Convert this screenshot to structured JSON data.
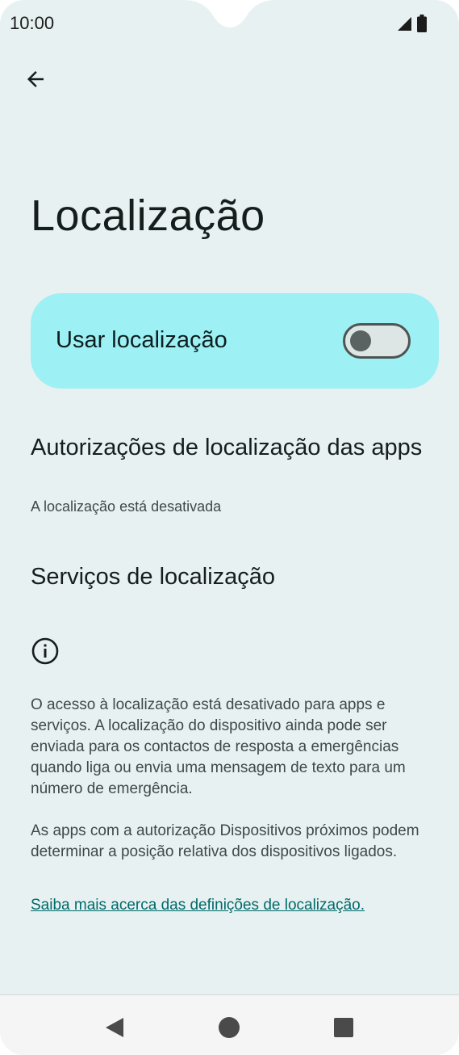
{
  "status_bar": {
    "time": "10:00"
  },
  "header": {
    "title": "Localização"
  },
  "main_switch": {
    "label": "Usar localização",
    "enabled": false
  },
  "items": [
    {
      "title": "Autorizações de localização das apps",
      "summary": "A localização está desativada"
    },
    {
      "title": "Serviços de localização"
    }
  ],
  "footer": {
    "paragraph1": "O acesso à localização está desativado para apps e serviços. A localização do dispositivo ainda pode ser enviada para os contactos de resposta a emergências quando liga ou envia uma mensagem de texto para um número de emergência.",
    "paragraph2": "As apps com a autorização Dispositivos próximos podem determinar a posição relativa dos dispositivos ligados.",
    "link": "Saiba mais acerca das definições de localização."
  },
  "colors": {
    "background": "#e8f1f1",
    "switch_card": "#9df0f4",
    "link": "#006a6a",
    "nav_bar": "#f5f5f5"
  },
  "icons": {
    "back": "arrow-left-icon",
    "info": "info-icon",
    "signal": "signal-icon",
    "battery": "battery-icon",
    "nav_back": "triangle-back-icon",
    "nav_home": "circle-home-icon",
    "nav_recents": "square-recents-icon"
  }
}
